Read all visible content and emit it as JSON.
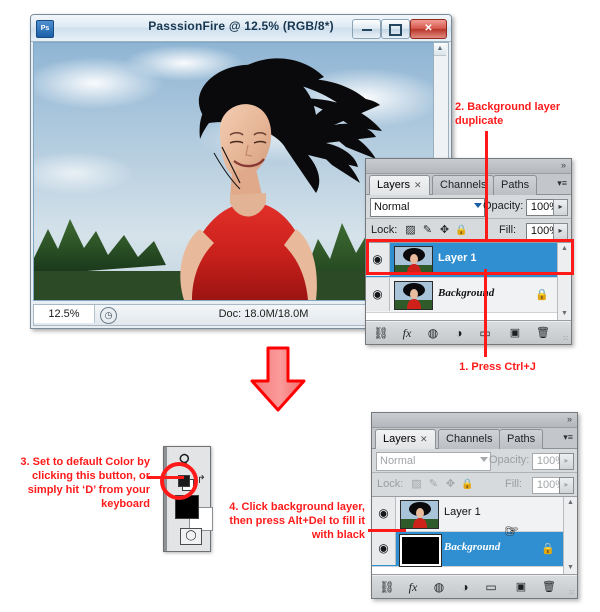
{
  "document_window": {
    "title": "PasssionFire @ 12.5% (RGB/8*)",
    "app_icon": "photoshop-icon",
    "buttons": {
      "minimize": "minimize-icon",
      "maximize": "maximize-icon",
      "close": "✕"
    },
    "status": {
      "zoom": "12.5%",
      "clock_icon": "clock-icon",
      "doc_info": "Doc: 18.0M/18.0M",
      "play_glyph": "▶",
      "prev_glyph": "◀"
    },
    "scroll": {
      "up": "▲",
      "down": "▼"
    },
    "photo_alt": "woman with flowing black hair in red tank top"
  },
  "panel_top": {
    "tabs": [
      {
        "label": "Layers",
        "close": "✕",
        "active": true
      },
      {
        "label": "Channels",
        "active": false
      },
      {
        "label": "Paths",
        "active": false
      }
    ],
    "collapse_icon": "»",
    "menu_icon": "▾≡",
    "blend_mode": "Normal",
    "opacity_label": "Opacity:",
    "opacity_value": "100%",
    "lock_label": "Lock:",
    "lock_icons": [
      "transparency-lock-icon",
      "brush-lock-icon",
      "move-lock-icon",
      "all-lock-icon"
    ],
    "lock_glyphs": [
      "▨",
      "✎",
      "✥",
      "🔒"
    ],
    "fill_label": "Fill:",
    "fill_value": "100%",
    "spinner": "▸",
    "layers": [
      {
        "name": "Layer 1",
        "selected": true,
        "eye": "👁",
        "thumb": "photo",
        "locked": false,
        "italic": false
      },
      {
        "name": "Background",
        "selected": false,
        "eye": "👁",
        "thumb": "photo",
        "locked": true,
        "italic": true,
        "lock_glyph": "🔒"
      }
    ],
    "footer_icons": [
      "link-icon",
      "fx-icon",
      "layer-mask-icon",
      "adjustment-layer-icon",
      "new-group-icon",
      "new-layer-icon",
      "delete-layer-icon"
    ],
    "footer_glyphs": [
      "⛓",
      "fx",
      "◍",
      "◑",
      "▭",
      "▣",
      "🗑"
    ]
  },
  "panel_bottom": {
    "tabs": [
      {
        "label": "Layers",
        "close": "✕",
        "active": true
      },
      {
        "label": "Channels",
        "active": false
      },
      {
        "label": "Paths",
        "active": false
      }
    ],
    "collapse_icon": "»",
    "menu_icon": "▾≡",
    "blend_mode": "Normal",
    "opacity_label": "Opacity:",
    "opacity_value": "100%",
    "lock_label": "Lock:",
    "fill_label": "Fill:",
    "fill_value": "100%",
    "spinner": "▸",
    "layers": [
      {
        "name": "Layer 1",
        "selected": false,
        "eye": "👁",
        "thumb": "photo",
        "locked": false,
        "italic": false
      },
      {
        "name": "Background",
        "selected": true,
        "eye": "👁",
        "thumb": "black",
        "locked": true,
        "italic": true,
        "lock_glyph": "🔒"
      }
    ],
    "cursor": "hand-cursor"
  },
  "toolbar": {
    "zoom_tool_icon": "magnifier-icon",
    "default_colors_icon": "default-colors-icon",
    "swap_colors_icon": "swap-colors-icon",
    "foreground_color": "#000000",
    "background_color": "#ffffff",
    "quick_mask_icon": "quick-mask-icon",
    "swap_glyph": "↱",
    "zoom_glyph": "⚲",
    "qmask_glyph": "◯"
  },
  "annotations": {
    "note1": "1. Press Ctrl+J",
    "note2": "2. Background layer duplicate",
    "note3": "3. Set to default Color by clicking this button, or simply hit ‘D’ from your keyboard",
    "note4": "4. Click background layer, then press Alt+Del to fill it with black"
  },
  "colors": {
    "annotation_red": "#ff1a1a",
    "selection_blue": "#2f8fd0",
    "arrow_fill": "#f98484",
    "arrow_stroke": "#ff0000"
  }
}
